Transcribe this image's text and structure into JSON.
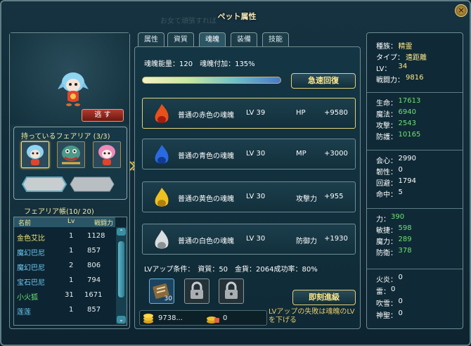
{
  "window": {
    "title": "ペット属性",
    "bg_text": "お女て頑張すれば",
    "close": "×"
  },
  "left": {
    "release_button": "逃 す",
    "fairy_title": "持っているフェアリア (3/3)",
    "recall_button": "回収",
    "carry_button": "携帯",
    "list_title": "フェアリア帳(10/ 20)",
    "headers": [
      "名前",
      "Lv",
      "戦闘力"
    ],
    "rows": [
      {
        "name": "金色艾比",
        "lv": "1",
        "power": "1128"
      },
      {
        "name": "魔幻巴尼",
        "lv": "1",
        "power": "857"
      },
      {
        "name": "魔幻巴尼",
        "lv": "2",
        "power": "806"
      },
      {
        "name": "宝石巴尼",
        "lv": "1",
        "power": "794"
      },
      {
        "name": "小火狐",
        "lv": "31",
        "power": "1671"
      },
      {
        "name": "莲莲",
        "lv": "1",
        "power": "857"
      }
    ]
  },
  "tabs": [
    "属性",
    "資質",
    "魂魄",
    "装備",
    "技能"
  ],
  "center": {
    "energy": "魂魄能量：120　魂魄付加：135%",
    "quick_recover": "急速回復",
    "souls": [
      {
        "name": "普通の赤色の魂魄",
        "lv": "LV 39",
        "stat": "HP",
        "value": "+9580",
        "color": "#e8501c"
      },
      {
        "name": "普通の青色の魂魄",
        "lv": "LV 30",
        "stat": "MP",
        "value": "+3000",
        "color": "#2a6ae0"
      },
      {
        "name": "普通の黄色の魂魄",
        "lv": "LV 30",
        "stat": "攻撃力",
        "value": "+955",
        "color": "#f0c020"
      },
      {
        "name": "普通の白色の魂魄",
        "lv": "LV 30",
        "stat": "防御力",
        "value": "+1930",
        "color": "#d8dde0"
      }
    ],
    "lvup_condition": "LVアップ条件：　資質：50　金貨：2064成功率：80%",
    "material_count": "30",
    "instant_upgrade": "即刻進級",
    "gold": "9738...",
    "locked_gold": "0",
    "hint": "LVアップの失敗は魂魄のLVを下げる"
  },
  "right": {
    "info": [
      {
        "label": "種族：",
        "value": "精霊",
        "color": "#ffe88a"
      },
      {
        "label": "タイプ：",
        "value": "遠距離",
        "color": "#ffe88a"
      },
      {
        "label": "LV：",
        "value": "34",
        "color": "#ffe88a"
      },
      {
        "label": "戦闘力：",
        "value": "9816",
        "color": "#ffe88a"
      }
    ],
    "stats": [
      {
        "label": "生命：",
        "value": "17613",
        "color": "#6fe06f"
      },
      {
        "label": "魔法：",
        "value": "6940",
        "color": "#6fe06f"
      },
      {
        "label": "攻撃：",
        "value": "2543",
        "color": "#6fe06f"
      },
      {
        "label": "防護：",
        "value": "10165",
        "color": "#6fe06f"
      }
    ],
    "combat": [
      {
        "label": "会心：",
        "value": "2990",
        "color": "#ffffff"
      },
      {
        "label": "韌性：",
        "value": "0",
        "color": "#ffffff"
      },
      {
        "label": "回避：",
        "value": "1794",
        "color": "#ffffff"
      },
      {
        "label": "命中：",
        "value": "5",
        "color": "#ffffff"
      }
    ],
    "attrs": [
      {
        "label": "力：",
        "value": "390",
        "color": "#6fe06f"
      },
      {
        "label": "敏捷：",
        "value": "598",
        "color": "#6fe06f"
      },
      {
        "label": "魔力：",
        "value": "289",
        "color": "#6fe06f"
      },
      {
        "label": "防衛：",
        "value": "378",
        "color": "#6fe06f"
      }
    ],
    "elements": [
      {
        "label": "火炎：",
        "value": "0",
        "color": "#ffffff"
      },
      {
        "label": "雷：",
        "value": "0",
        "color": "#ffffff"
      },
      {
        "label": "吹雪：",
        "value": "0",
        "color": "#ffffff"
      },
      {
        "label": "神聖：",
        "value": "0",
        "color": "#ffffff"
      }
    ]
  }
}
